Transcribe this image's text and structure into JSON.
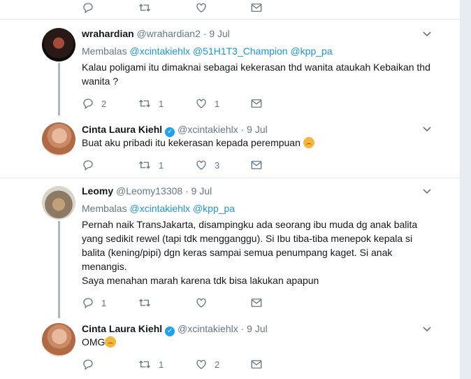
{
  "tweets": [
    {
      "id": "t0",
      "actions": {
        "reply": "",
        "retweet": "",
        "like": ""
      }
    },
    {
      "id": "t1",
      "name": "wrahardian",
      "handle": "@wrahardian2",
      "dot": "·",
      "date": "9 Jul",
      "reply_prefix": "Membalas",
      "mentions": [
        "@xcintakiehlx",
        "@51H1T3_Champion",
        "@kpp_pa"
      ],
      "text": "Kalau poligami itu dimaknai sebagai kekerasan thd wanita ataukah Kebaikan thd wanita ?",
      "actions": {
        "reply": "2",
        "retweet": "1",
        "like": "1"
      }
    },
    {
      "id": "t2",
      "name": "Cinta Laura Kiehl",
      "verified": true,
      "handle": "@xcintakiehlx",
      "dot": "·",
      "date": "9 Jul",
      "text": "Buat aku pribadi itu kekerasan kepada perempuan",
      "emoji": "disappointed-face",
      "actions": {
        "reply": "",
        "retweet": "1",
        "like": "3"
      }
    },
    {
      "id": "t3",
      "name": "Leomy",
      "handle": "@Leomy13308",
      "dot": "·",
      "date": "9 Jul",
      "reply_prefix": "Membalas",
      "mentions": [
        "@xcintakiehlx",
        "@kpp_pa"
      ],
      "text_lines": [
        "Pernah naik TransJakarta, disampingku ada seorang ibu muda dg anak balita",
        "yang sedikit rewel (tapi tdk mengganggu). Si Ibu tiba-tiba menepok kepala si",
        "balita (kening/pipi) dgn keras sampai semua penumpang kaget. Si anak",
        "menangis.",
        "Saya menahan marah karena tdk bisa lakukan apapun"
      ],
      "actions": {
        "reply": "1",
        "retweet": "",
        "like": ""
      }
    },
    {
      "id": "t4",
      "name": "Cinta Laura Kiehl",
      "verified": true,
      "handle": "@xcintakiehlx",
      "dot": "·",
      "date": "9 Jul",
      "text": "OMG",
      "emoji": "disappointed-face",
      "actions": {
        "reply": "",
        "retweet": "1",
        "like": "2"
      }
    }
  ],
  "icons": {
    "reply": "reply-icon",
    "retweet": "retweet-icon",
    "like": "heart-icon",
    "dm": "envelope-icon",
    "menu": "chevron-down-icon",
    "verified": "verified-badge-icon"
  },
  "colors": {
    "link": "#1b95e0",
    "muted": "#657786",
    "thread_line": "#aab8c2",
    "verified": "#1da1f2",
    "background": "#e6ecf0"
  }
}
